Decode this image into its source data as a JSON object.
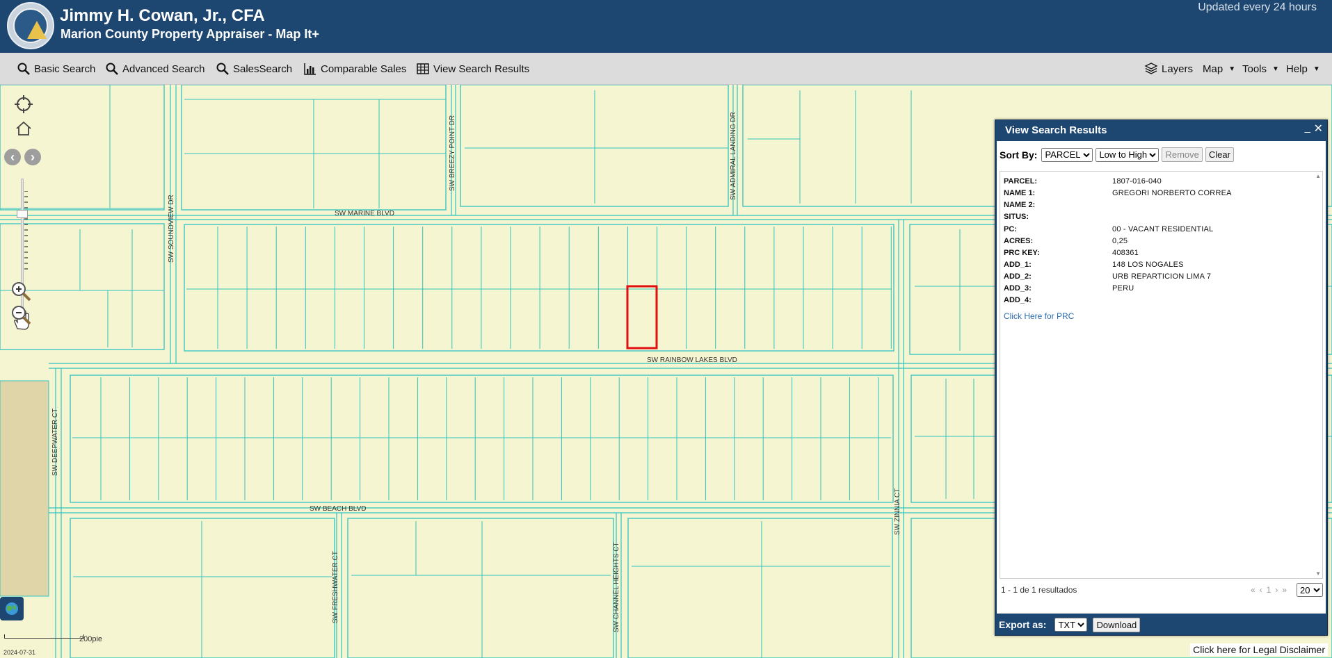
{
  "header": {
    "title": "Jimmy H. Cowan, Jr., CFA",
    "subtitle": "Marion County Property Appraiser - Map It+",
    "updated_note": "Updated every 24 hours"
  },
  "toolbar": {
    "left": [
      {
        "label": "Basic Search",
        "icon": "search-icon"
      },
      {
        "label": "Advanced Search",
        "icon": "search-icon"
      },
      {
        "label": "SalesSearch",
        "icon": "search-icon"
      },
      {
        "label": "Comparable Sales",
        "icon": "bar-chart-icon"
      },
      {
        "label": "View Search Results",
        "icon": "table-icon"
      }
    ],
    "right": [
      {
        "label": "Layers",
        "icon": "layers-icon"
      },
      {
        "label": "Map"
      },
      {
        "label": "Tools"
      },
      {
        "label": "Help"
      }
    ]
  },
  "map": {
    "streets": {
      "marine": "SW MARINE BLVD",
      "rainbow": "SW RAINBOW LAKES BLVD",
      "beach": "SW BEACH BLVD",
      "soundview": "SW SOUNDVIEW DR",
      "breezy": "SW BREEZY POINT DR",
      "admiral": "SW ADMIRAL LANDING DR",
      "deepwater": "SW DEEPWATER CT",
      "freshwater": "SW FRESHWATER CT",
      "channel": "SW CHANNEL HEIGHTS CT",
      "zinnia": "SW ZINNIA CT"
    },
    "scale_label": "200pie",
    "date": "2024-07-31",
    "legal_disclaimer": "Click here for Legal Disclaimer",
    "colors": {
      "parcel_fill": "#f6f5d1",
      "parcel_line": "#2ec4c0",
      "highlight": "#e01010",
      "road": "#f6f5d1"
    }
  },
  "panel": {
    "title": "View Search Results",
    "sort_label": "Sort By:",
    "sort_field": "PARCEL",
    "sort_order": "Low to High",
    "remove_label": "Remove",
    "clear_label": "Clear",
    "fields": [
      {
        "key": "PARCEL:",
        "value": "1807-016-040"
      },
      {
        "key": "NAME 1:",
        "value": "GREGORI NORBERTO CORREA"
      },
      {
        "key": "NAME 2:",
        "value": ""
      },
      {
        "key": "SITUS:",
        "value": ""
      },
      {
        "key": "PC:",
        "value": "00 - VACANT RESIDENTIAL"
      },
      {
        "key": "ACRES:",
        "value": "0,25"
      },
      {
        "key": "PRC KEY:",
        "value": "408361"
      },
      {
        "key": "ADD_1:",
        "value": "148 LOS NOGALES"
      },
      {
        "key": "ADD_2:",
        "value": "URB REPARTICION LIMA 7"
      },
      {
        "key": "ADD_3:",
        "value": "PERU"
      },
      {
        "key": "ADD_4:",
        "value": ""
      }
    ],
    "prc_link": "Click Here for PRC",
    "result_count": "1 - 1 de 1 resultados",
    "pager_page": "1",
    "page_size": "20",
    "export_label": "Export as:",
    "export_format": "TXT",
    "download_label": "Download"
  }
}
